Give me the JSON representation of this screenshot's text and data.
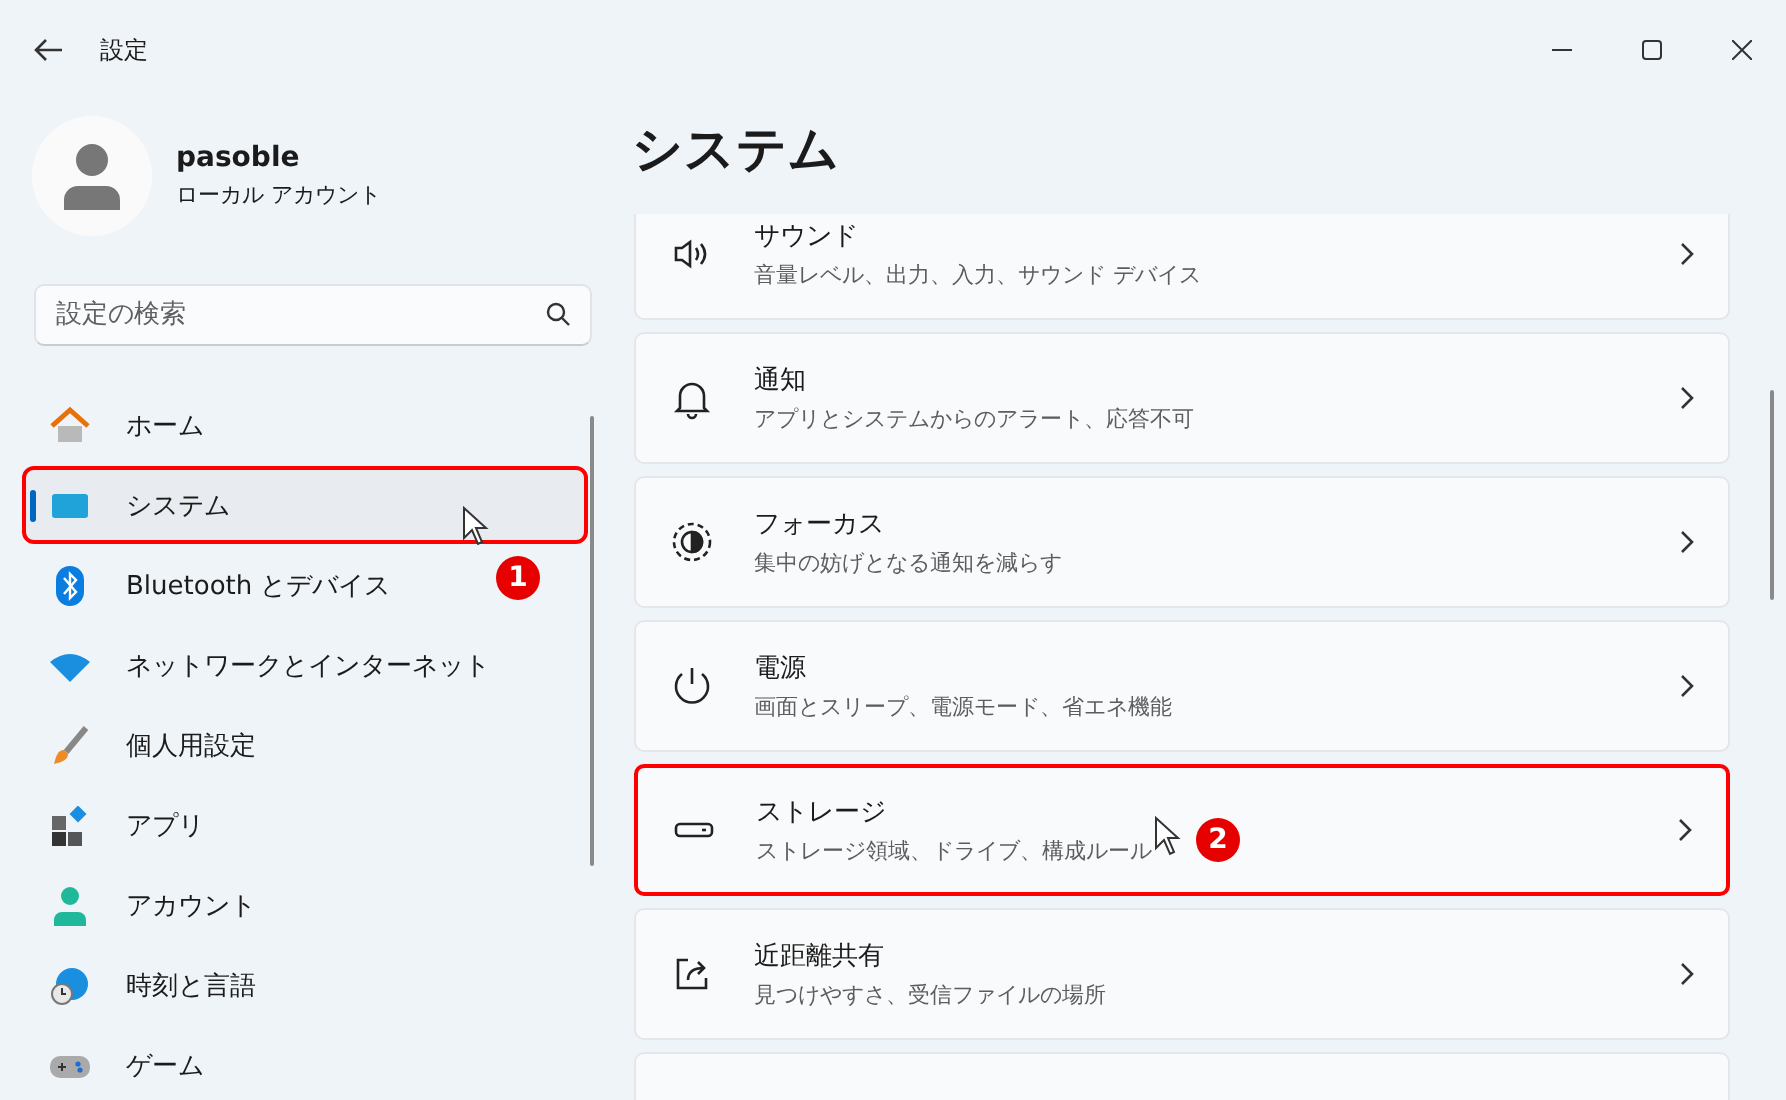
{
  "window": {
    "title": "設定"
  },
  "profile": {
    "name": "pasoble",
    "account_type": "ローカル アカウント"
  },
  "search": {
    "placeholder": "設定の検索"
  },
  "nav": [
    {
      "label": "ホーム",
      "selected": false
    },
    {
      "label": "システム",
      "selected": true
    },
    {
      "label": "Bluetooth とデバイス",
      "selected": false
    },
    {
      "label": "ネットワークとインターネット",
      "selected": false
    },
    {
      "label": "個人用設定",
      "selected": false
    },
    {
      "label": "アプリ",
      "selected": false
    },
    {
      "label": "アカウント",
      "selected": false
    },
    {
      "label": "時刻と言語",
      "selected": false
    },
    {
      "label": "ゲーム",
      "selected": false
    }
  ],
  "page_title": "システム",
  "cards": [
    {
      "title": "サウンド",
      "subtitle": "音量レベル、出力、入力、サウンド デバイス",
      "highlighted": false
    },
    {
      "title": "通知",
      "subtitle": "アプリとシステムからのアラート、応答不可",
      "highlighted": false
    },
    {
      "title": "フォーカス",
      "subtitle": "集中の妨げとなる通知を減らす",
      "highlighted": false
    },
    {
      "title": "電源",
      "subtitle": "画面とスリープ、電源モード、省エネ機能",
      "highlighted": false
    },
    {
      "title": "ストレージ",
      "subtitle": "ストレージ領域、ドライブ、構成ルール",
      "highlighted": true,
      "step": "2"
    },
    {
      "title": "近距離共有",
      "subtitle": "見つけやすさ、受信ファイルの場所",
      "highlighted": false
    }
  ],
  "nav_step": "1"
}
